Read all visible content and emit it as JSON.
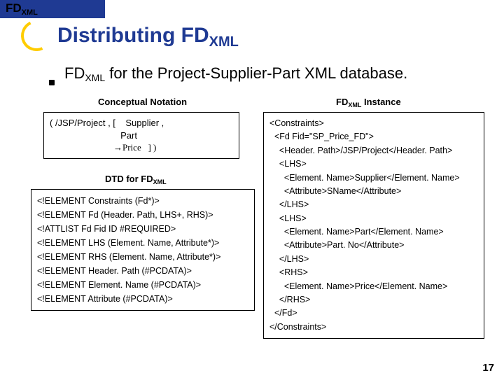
{
  "header": {
    "logo_fd": "FD",
    "logo_xml": "XML"
  },
  "title": {
    "prefix": "Distributing ",
    "fd": "FD",
    "xml": "XML"
  },
  "bullet": {
    "fd": "FD",
    "xml": "XML",
    "suffix": " for the Project-Supplier-Part XML database."
  },
  "labels": {
    "conceptual": "Conceptual Notation",
    "instance_fd": "FD",
    "instance_xml": "XML",
    "instance_suffix": " Instance",
    "dtd_prefix": "DTD for ",
    "dtd_fd": "FD",
    "dtd_xml": "XML"
  },
  "conceptual": {
    "l1": "( /JSP/Project , [    Supplier ,",
    "l2": "                            Part",
    "l3": "                            →Price   ] )"
  },
  "dtd": [
    "<!ELEMENT Constraints (Fd*)>",
    "<!ELEMENT Fd (Header. Path, LHS+, RHS)>",
    "<!ATTLIST Fd Fid ID #REQUIRED>",
    "<!ELEMENT LHS (Element. Name, Attribute*)>",
    "<!ELEMENT RHS (Element. Name, Attribute*)>",
    "<!ELEMENT Header. Path (#PCDATA)>",
    "<!ELEMENT Element. Name (#PCDATA)>",
    "<!ELEMENT Attribute (#PCDATA)>"
  ],
  "instance": [
    "<Constraints>",
    "  <Fd Fid=\"SP_Price_FD\">",
    "    <Header. Path>/JSP/Project</Header. Path>",
    "    <LHS>",
    "      <Element. Name>Supplier</Element. Name>",
    "      <Attribute>SName</Attribute>",
    "    </LHS>",
    "    <LHS>",
    "      <Element. Name>Part</Element. Name>",
    "      <Attribute>Part. No</Attribute>",
    "    </LHS>",
    "    <RHS>",
    "      <Element. Name>Price</Element. Name>",
    "    </RHS>",
    "  </Fd>",
    "</Constraints>"
  ],
  "page_number": "17"
}
